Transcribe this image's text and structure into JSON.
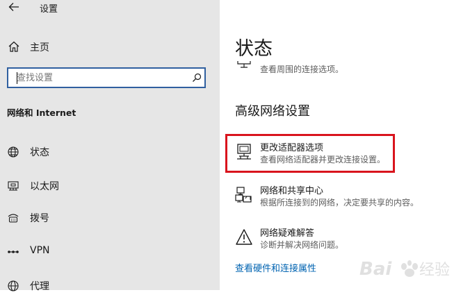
{
  "window": {
    "title": "设置"
  },
  "sidebar": {
    "home_label": "主页",
    "search": {
      "placeholder": "查找设置",
      "value": ""
    },
    "section_heading": "网络和 Internet",
    "items": [
      {
        "label": "状态",
        "icon": "globe-icon"
      },
      {
        "label": "以太网",
        "icon": "ethernet-icon"
      },
      {
        "label": "拨号",
        "icon": "dialup-icon"
      },
      {
        "label": "VPN",
        "icon": "vpn-icon"
      },
      {
        "label": "代理",
        "icon": "proxy-globe-icon"
      }
    ]
  },
  "main": {
    "title": "状态",
    "previous_option_desc": "查看周围的连接选项。",
    "advanced_heading": "高级网络设置",
    "options": [
      {
        "title": "更改适配器选项",
        "desc": "查看网络适配器并更改连接设置。",
        "icon": "adapter-monitor-icon",
        "highlighted": true
      },
      {
        "title": "网络和共享中心",
        "desc": "根据所连接到的网络，决定要共享的内容。",
        "icon": "sharing-center-icon"
      },
      {
        "title": "网络疑难解答",
        "desc": "诊断并解决网络问题。",
        "icon": "warning-triangle-icon"
      }
    ],
    "hardware_link": "查看硬件和连接属性"
  },
  "colors": {
    "sidebar_bg": "#e6e6e6",
    "main_bg": "#ffffff",
    "search_border": "#2f5f9f",
    "highlight_border": "#d9141d",
    "link": "#0063b1"
  }
}
